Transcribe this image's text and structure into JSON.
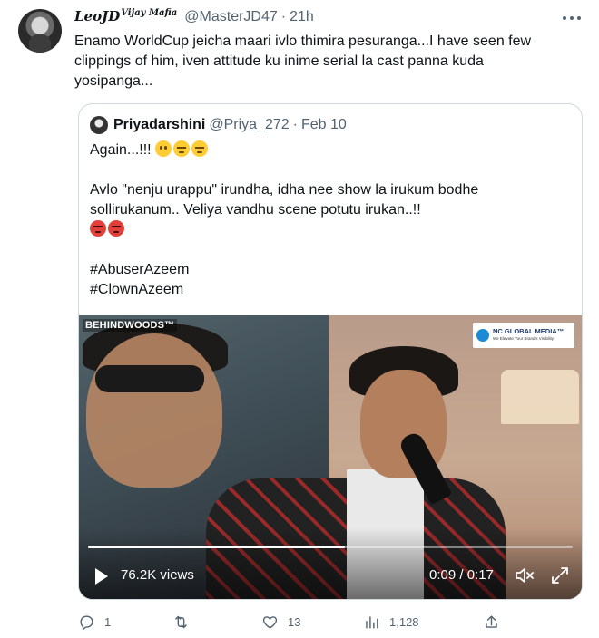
{
  "tweet": {
    "display_name": "LeoJD",
    "display_name_sup": "Vijay Mafia",
    "handle": "@MasterJD47",
    "separator": "·",
    "time": "21h",
    "text": "Enamo WorldCup jeicha maari ivlo thimira pesuranga...I have seen few clippings of him, iven attitude ku inime serial la cast panna kuda yosipanga..."
  },
  "quote": {
    "display_name": "Priyadarshini",
    "handle": "@Priya_272",
    "separator": "·",
    "time": "Feb 10",
    "line1": "Again...!!!",
    "line1_emojis": [
      "worried-face-icon",
      "pensive-face-icon",
      "pensive-face-icon"
    ],
    "line2": "Avlo \"nenju urappu\" irundha, idha nee show la irukum bodhe sollirukanum.. Veliya vandhu scene potutu irukan..!!",
    "line2_emojis": [
      "angry-face-icon",
      "angry-face-icon"
    ],
    "hashtag1": "#AbuserAzeem",
    "hashtag2": "#ClownAzeem"
  },
  "video": {
    "watermark": "BEHINDWOODS™",
    "brand_name": "NC GLOBAL MEDIA™",
    "brand_tagline": "We Elevate Your Brand's Visibility",
    "views": "76.2K views",
    "timestamp": "0:09 / 0:17",
    "progress_fraction": 0.53
  },
  "actions": {
    "replies": "1",
    "retweets": "",
    "likes": "13",
    "views": "1,128",
    "share": ""
  },
  "colors": {
    "text_primary": "#0f1419",
    "text_secondary": "#536471",
    "border": "#cfd9de"
  }
}
